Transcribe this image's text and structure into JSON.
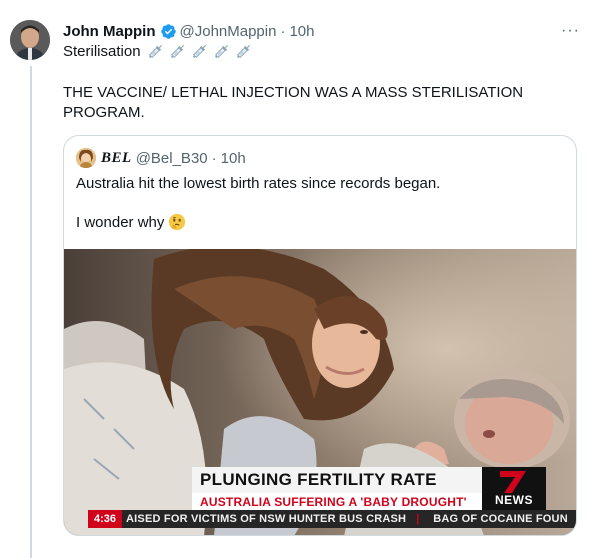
{
  "tweet": {
    "author_name": "John Mappin",
    "handle": "@JohnMappin",
    "time": "10h",
    "first_line": "Sterilisation",
    "text": "THE VACCINE/ LETHAL INJECTION WAS A MASS STERILISATION PROGRAM.",
    "more_label": "···"
  },
  "quote": {
    "author_name": "BEL",
    "handle": "@Bel_B30",
    "time": "10h",
    "text_line1": "Australia hit the lowest birth rates since records began.",
    "text_line2": "I wonder why"
  },
  "video": {
    "headline": "PLUNGING FERTILITY RATE",
    "subheadline": "AUSTRALIA SUFFERING A 'BABY DROUGHT'",
    "logo_text": "NEWS",
    "ticker_time": "4:36",
    "ticker_text_1": "AISED FOR VICTIMS OF NSW HUNTER BUS CRASH",
    "ticker_text_2": "BAG OF COCAINE FOUN"
  },
  "colors": {
    "verified": "#1d9bf0",
    "muted_text": "#536471",
    "news_red": "#d0021b"
  }
}
